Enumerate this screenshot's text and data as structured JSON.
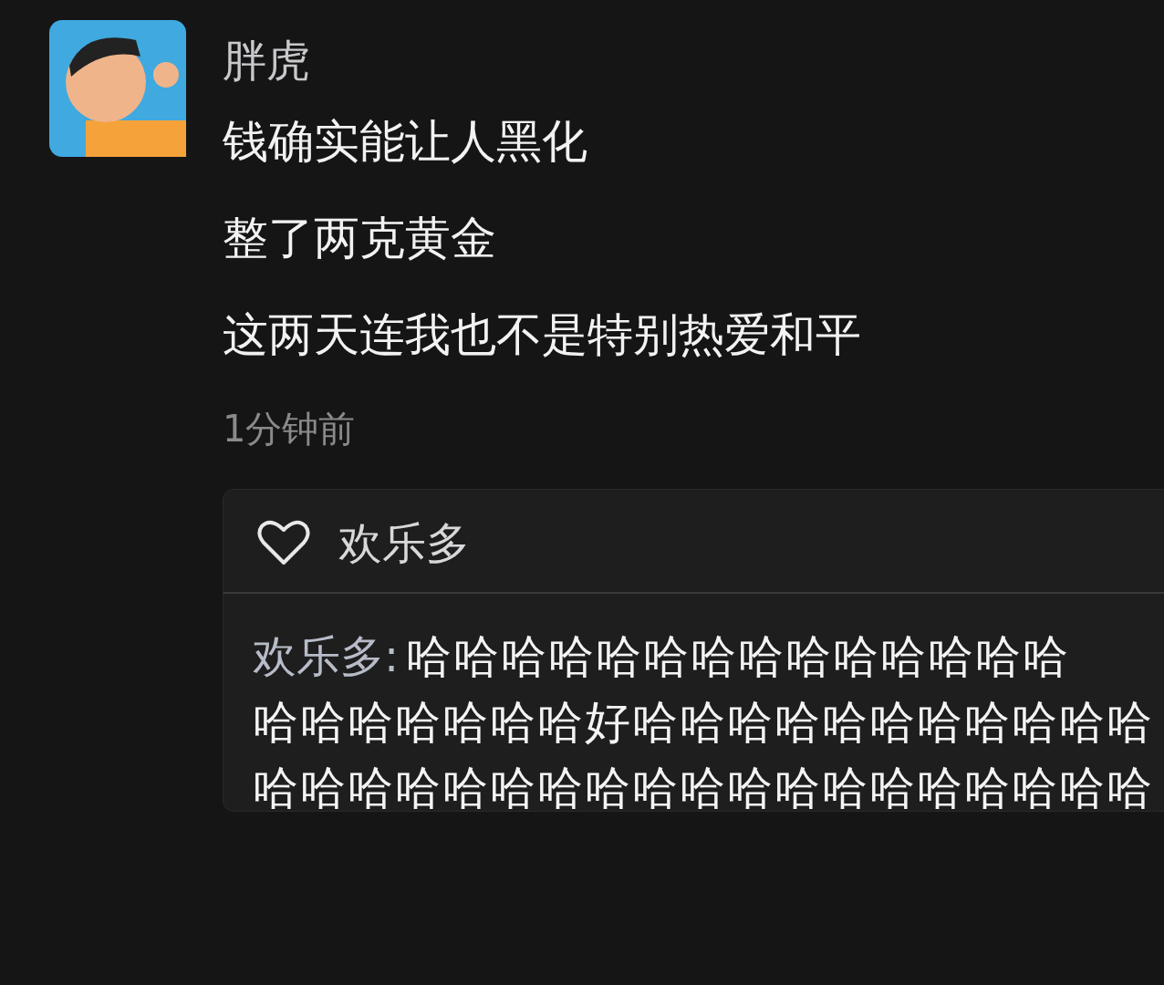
{
  "post": {
    "author": "胖虎",
    "paragraphs": [
      "钱确实能让人黑化",
      "整了两克黄金",
      "这两天连我也不是特别热爱和平"
    ],
    "time": "1分钟前"
  },
  "likes": {
    "names": "欢乐多"
  },
  "comment": {
    "author": "欢乐多:",
    "lines": [
      "哈哈哈哈哈哈哈哈哈哈哈哈哈哈",
      "哈哈哈哈哈哈哈好哈哈哈哈哈哈哈哈哈哈哈",
      "哈哈哈哈哈哈哈哈哈哈哈哈哈哈哈哈哈哈哈"
    ]
  }
}
